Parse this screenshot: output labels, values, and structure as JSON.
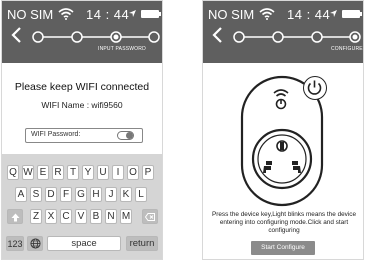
{
  "left_screen": {
    "status": {
      "carrier": "NO SIM",
      "time": "14 : 44"
    },
    "step_label": "INPUT PASSWORD",
    "message": "Please keep WIFI connected",
    "wifi_name": "WIFI Name : wifi9560",
    "password_label": "WIFI Password:",
    "keyboard": {
      "row1": [
        "Q",
        "W",
        "E",
        "R",
        "T",
        "Y",
        "U",
        "I",
        "O",
        "P"
      ],
      "row2": [
        "A",
        "S",
        "D",
        "F",
        "G",
        "H",
        "J",
        "K",
        "L"
      ],
      "row3": [
        "Z",
        "X",
        "C",
        "V",
        "B",
        "N",
        "M"
      ],
      "num_key": "123",
      "space_key": "space",
      "return_key": "return"
    }
  },
  "right_screen": {
    "status": {
      "carrier": "NO SIM",
      "time": "14 : 44"
    },
    "step_label": "CONFIGURE",
    "instruction": "Press the device key,Light blinks means the device entering into configuring mode.Click and start configuring",
    "start_button": "Start Configure"
  },
  "icons": [
    "wifi-icon",
    "location-arrow-icon",
    "battery-icon",
    "back-chevron-icon",
    "power-icon",
    "shift-icon",
    "delete-icon",
    "globe-icon"
  ]
}
